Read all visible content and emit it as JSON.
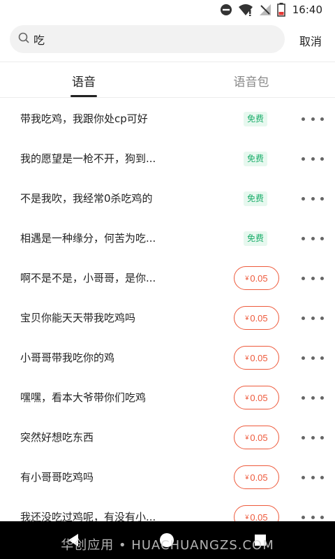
{
  "status_bar": {
    "time": "16:40",
    "icons": [
      "do-not-disturb-icon",
      "wifi-icon",
      "no-signal-icon",
      "battery-low-icon"
    ]
  },
  "search": {
    "icon": "search-icon",
    "value": "吃",
    "cancel_label": "取消"
  },
  "tabs": [
    {
      "label": "语音",
      "active": true
    },
    {
      "label": "语音包",
      "active": false
    }
  ],
  "items": [
    {
      "title": "带我吃鸡，我跟你处cp可好",
      "badge": "免费",
      "type": "free"
    },
    {
      "title": "我的愿望是一枪不开，狗到...",
      "badge": "免费",
      "type": "free"
    },
    {
      "title": "不是我吹，我经常0杀吃鸡的",
      "badge": "免费",
      "type": "free"
    },
    {
      "title": "相遇是一种缘分，何苦为吃...",
      "badge": "免费",
      "type": "free"
    },
    {
      "title": "啊不是不是，小哥哥，是你...",
      "badge": "0.05",
      "type": "paid"
    },
    {
      "title": "宝贝你能天天带我吃鸡吗",
      "badge": "0.05",
      "type": "paid"
    },
    {
      "title": "小哥哥带我吃你的鸡",
      "badge": "0.05",
      "type": "paid"
    },
    {
      "title": "嘿嘿，看本大爷带你们吃鸡",
      "badge": "0.05",
      "type": "paid"
    },
    {
      "title": "突然好想吃东西",
      "badge": "0.05",
      "type": "paid"
    },
    {
      "title": "有小哥哥吃鸡吗",
      "badge": "0.05",
      "type": "paid"
    },
    {
      "title": "我还没吃过鸡呢，有没有小...",
      "badge": "0.05",
      "type": "paid"
    }
  ],
  "currency_symbol": "¥",
  "watermark": "华创应用 • HUACHUANGZS.COM",
  "colors": {
    "accent_price": "#ee5a3c",
    "free_text": "#1aad6a",
    "free_bg": "#e7f8ef"
  }
}
